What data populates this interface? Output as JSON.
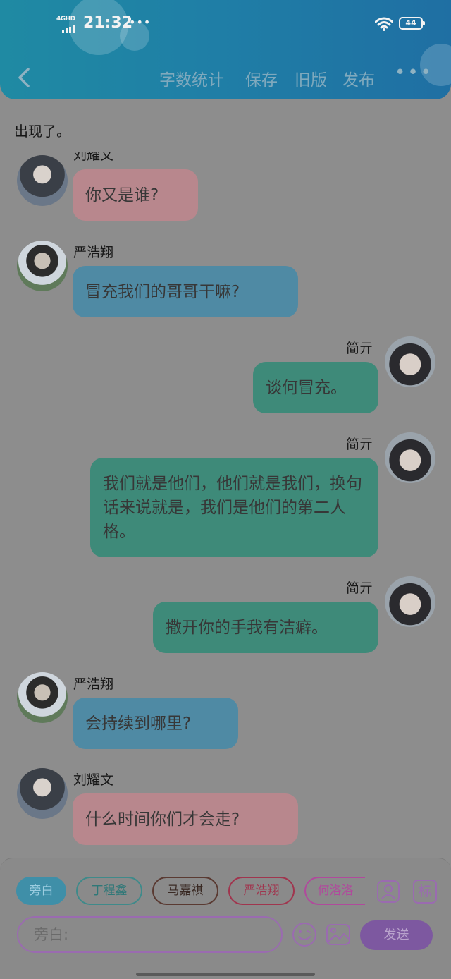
{
  "status_bar": {
    "network": "4GHD",
    "time": "21:32",
    "dots": "•••",
    "battery": "44"
  },
  "toolbar": {
    "word_count": "字数统计",
    "save": "保存",
    "old_version": "旧版",
    "publish": "发布",
    "more": "•••"
  },
  "narration_tail": "出现了。",
  "messages": [
    {
      "speaker": "刘耀文",
      "side": "left",
      "text": "你又是谁?",
      "color": "pink"
    },
    {
      "speaker": "严浩翔",
      "side": "left",
      "text": "冒充我们的哥哥干嘛?",
      "color": "blue"
    },
    {
      "speaker": "简亓",
      "side": "right",
      "text": "谈何冒充。",
      "color": "teal"
    },
    {
      "speaker": "简亓",
      "side": "right",
      "text": "我们就是他们，他们就是我们，换句话来说就是，我们是他们的第二人格。",
      "color": "teal"
    },
    {
      "speaker": "简亓",
      "side": "right",
      "text": "撒开你的手我有洁癖。",
      "color": "teal"
    },
    {
      "speaker": "严浩翔",
      "side": "left",
      "text": "会持续到哪里?",
      "color": "blue"
    },
    {
      "speaker": "刘耀文",
      "side": "left",
      "text": "什么时间你们才会走?",
      "color": "pink"
    }
  ],
  "character_tabs": [
    {
      "label": "旁白",
      "active": true
    },
    {
      "label": "丁程鑫",
      "active": false
    },
    {
      "label": "马嘉祺",
      "active": false
    },
    {
      "label": "严浩翔",
      "active": false
    },
    {
      "label": "何洛洛",
      "active": false
    }
  ],
  "tools": {
    "role_icon": "person-card-icon",
    "tag_label": "标"
  },
  "input": {
    "placeholder": "旁白:",
    "value": ""
  },
  "send_label": "发送",
  "colors": {
    "header": "#1f7fa6",
    "bubble_pink": "#b8878d",
    "bubble_blue": "#4f8aa4",
    "bubble_teal": "#3e8a79",
    "accent_purple": "#9a6bb0"
  }
}
